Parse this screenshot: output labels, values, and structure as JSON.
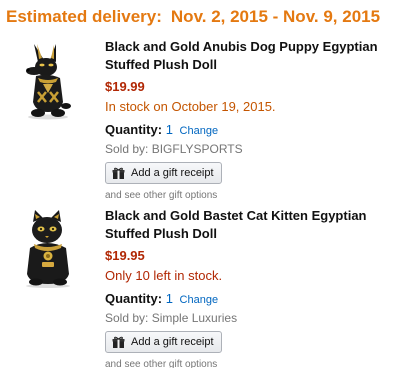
{
  "delivery": {
    "label": "Estimated delivery:",
    "range": "Nov. 2, 2015 - Nov. 9, 2015"
  },
  "items": [
    {
      "image": "black-anubis-dog-plush",
      "title": "Black and Gold Anubis Dog Puppy Egyptian Stuffed Plush Doll",
      "price": "$19.99",
      "stock": "In stock on October 19, 2015.",
      "quantity_label": "Quantity:",
      "quantity_value": "1",
      "change_label": "Change",
      "sold_by": "Sold by: BIGFLYSPORTS",
      "gift_label": "Add a gift receipt",
      "gift_icon": "gift-icon",
      "more_options": "and see other gift options"
    },
    {
      "image": "black-bastet-cat-plush",
      "title": "Black and Gold Bastet Cat Kitten Egyptian Stuffed Plush Doll",
      "price": "$19.95",
      "stock": "Only 10 left in stock.",
      "quantity_label": "Quantity:",
      "quantity_value": "1",
      "change_label": "Change",
      "sold_by": "Sold by: Simple Luxuries",
      "gift_label": "Add a gift receipt",
      "gift_icon": "gift-icon",
      "more_options": "and see other gift options"
    }
  ],
  "colors": {
    "delivery": "#e47911",
    "price": "#b12704",
    "in_stock": "#c45500",
    "low_stock": "#b12704",
    "link": "#0066c0",
    "muted": "#767676"
  }
}
